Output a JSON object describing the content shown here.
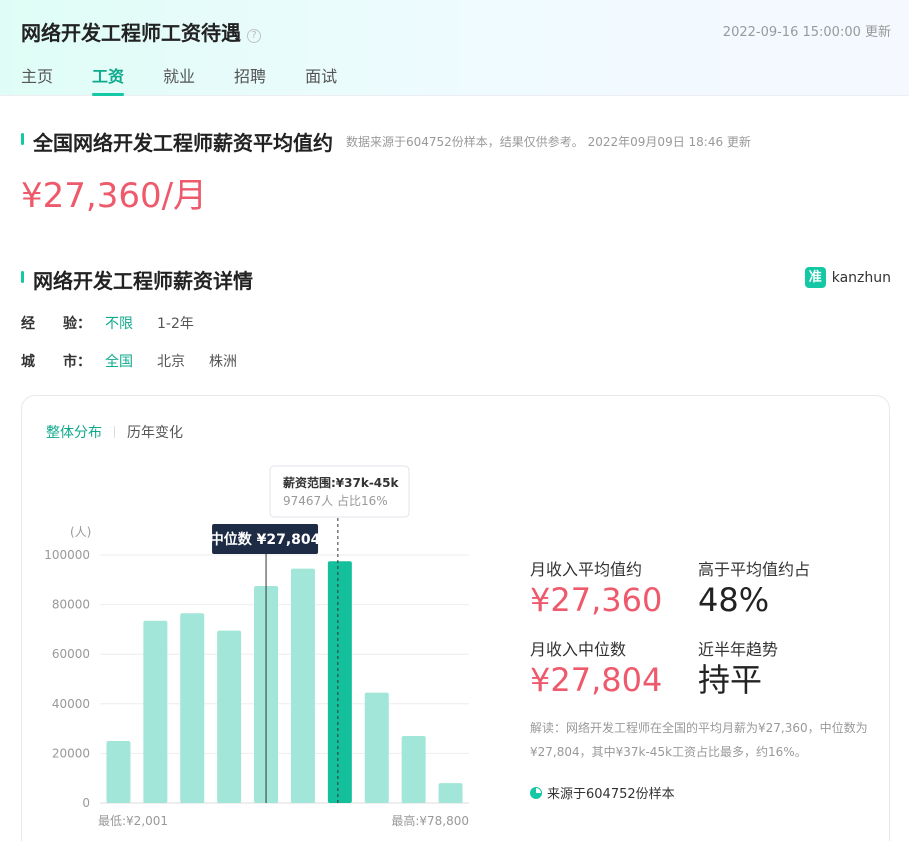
{
  "header": {
    "title": "网络开发工程师工资待遇",
    "help_icon": "?",
    "updated": "2022-09-16 15:00:00 更新",
    "tabs": [
      "主页",
      "工资",
      "就业",
      "招聘",
      "面试"
    ],
    "active_tab": 1
  },
  "avg_section": {
    "title": "全国网络开发工程师薪资平均值约",
    "subtitle": "数据来源于604752份样本，结果仅供参考。   2022年09月09日 18:46 更新",
    "value": "¥27,360/月"
  },
  "detail_section": {
    "title": "网络开发工程师薪资详情",
    "brand_logo": "准",
    "brand_name": "kanzhun"
  },
  "filters": {
    "experience": {
      "label": "经　　验：",
      "options": [
        "不限",
        "1-2年"
      ],
      "active": 0
    },
    "city": {
      "label": "城　　市：",
      "options": [
        "全国",
        "北京",
        "株洲"
      ],
      "active": 0
    }
  },
  "card": {
    "subtabs": [
      "整体分布",
      "历年变化"
    ],
    "active_subtab": 0
  },
  "chart_data": {
    "type": "bar",
    "ylabel": "(人)",
    "ylim": [
      0,
      100000
    ],
    "yticks": [
      0,
      20000,
      40000,
      60000,
      80000,
      100000
    ],
    "values": [
      25000,
      73500,
      76500,
      69500,
      87500,
      94500,
      97467,
      44500,
      27000,
      8000
    ],
    "highlight_index": 6,
    "x_min_label": "最低:¥2,001",
    "x_max_label": "最高:¥78,800",
    "median_label": "中位数 ¥27,804",
    "median_position": 4.5,
    "tooltip": {
      "title": "薪资范围:¥37k-45k",
      "body": "97467人  占比16%"
    },
    "colors": {
      "bar": "#a1e6d8",
      "highlight": "#14c09c",
      "grid": "#eeeeee"
    }
  },
  "stats": {
    "avg_label": "月收入平均值约",
    "avg_value": "¥27,360",
    "above_label": "高于平均值约占",
    "above_value": "48%",
    "median_label": "月收入中位数",
    "median_value": "¥27,804",
    "trend_label": "近半年趋势",
    "trend_value": "持平"
  },
  "interpretation": "解读：网络开发工程师在全国的平均月薪为¥27,360，中位数为¥27,804，其中¥37k-45k工资占比最多，约16%。",
  "source": "来源于604752份样本"
}
